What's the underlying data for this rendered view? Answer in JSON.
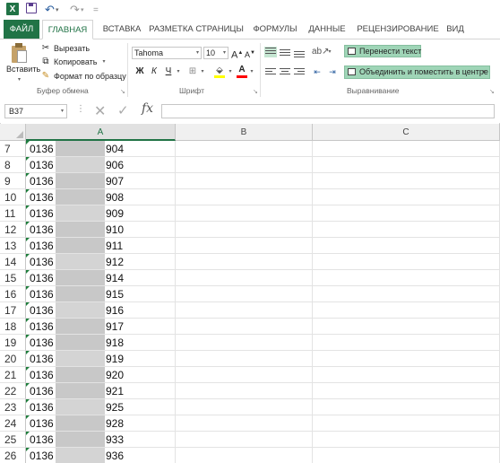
{
  "app": {
    "logo_letter": "X"
  },
  "qat": {
    "separator": "="
  },
  "tabs": [
    "ФАЙЛ",
    "ГЛАВНАЯ",
    "ВСТАВКА",
    "РАЗМЕТКА СТРАНИЦЫ",
    "ФОРМУЛЫ",
    "ДАННЫЕ",
    "РЕЦЕНЗИРОВАНИЕ",
    "ВИД"
  ],
  "active_tab": "ГЛАВНАЯ",
  "ribbon": {
    "clipboard": {
      "paste": "Вставить",
      "cut": "Вырезать",
      "copy": "Копировать",
      "format_painter": "Формат по образцу",
      "label": "Буфер обмена"
    },
    "font": {
      "name": "Tahoma",
      "size": "10",
      "grow": "A",
      "shrink": "A",
      "bold": "Ж",
      "italic": "К",
      "underline": "Ч",
      "font_color_letter": "A",
      "label": "Шрифт"
    },
    "alignment": {
      "wrap_text": "Перенести текст",
      "merge_center": "Объединить и поместить в центре",
      "label": "Выравнивание"
    },
    "colors": {
      "accent": "#217346",
      "highlight": "#9fd5b7",
      "fill_yellow": "#ffff00",
      "font_red": "#ff0000"
    }
  },
  "formula_bar": {
    "name_box": "B37",
    "fx": "fx",
    "value": ""
  },
  "columns": [
    "A",
    "B",
    "C"
  ],
  "rows": [
    {
      "num": "7",
      "prefix": "0136",
      "suffix": "904"
    },
    {
      "num": "8",
      "prefix": "0136",
      "suffix": "906"
    },
    {
      "num": "9",
      "prefix": "0136",
      "suffix": "907"
    },
    {
      "num": "10",
      "prefix": "0136",
      "suffix": "908"
    },
    {
      "num": "11",
      "prefix": "0136",
      "suffix": "909"
    },
    {
      "num": "12",
      "prefix": "0136",
      "suffix": "910"
    },
    {
      "num": "13",
      "prefix": "0136",
      "suffix": "911"
    },
    {
      "num": "14",
      "prefix": "0136",
      "suffix": "912"
    },
    {
      "num": "15",
      "prefix": "0136",
      "suffix": "914"
    },
    {
      "num": "16",
      "prefix": "0136",
      "suffix": "915"
    },
    {
      "num": "17",
      "prefix": "0136",
      "suffix": "916"
    },
    {
      "num": "18",
      "prefix": "0136",
      "suffix": "917"
    },
    {
      "num": "19",
      "prefix": "0136",
      "suffix": "918"
    },
    {
      "num": "20",
      "prefix": "0136",
      "suffix": "919"
    },
    {
      "num": "21",
      "prefix": "0136",
      "suffix": "920"
    },
    {
      "num": "22",
      "prefix": "0136",
      "suffix": "921"
    },
    {
      "num": "23",
      "prefix": "0136",
      "suffix": "925"
    },
    {
      "num": "24",
      "prefix": "0136",
      "suffix": "928"
    },
    {
      "num": "25",
      "prefix": "0136",
      "suffix": "933"
    },
    {
      "num": "26",
      "prefix": "0136",
      "suffix": "936"
    }
  ]
}
